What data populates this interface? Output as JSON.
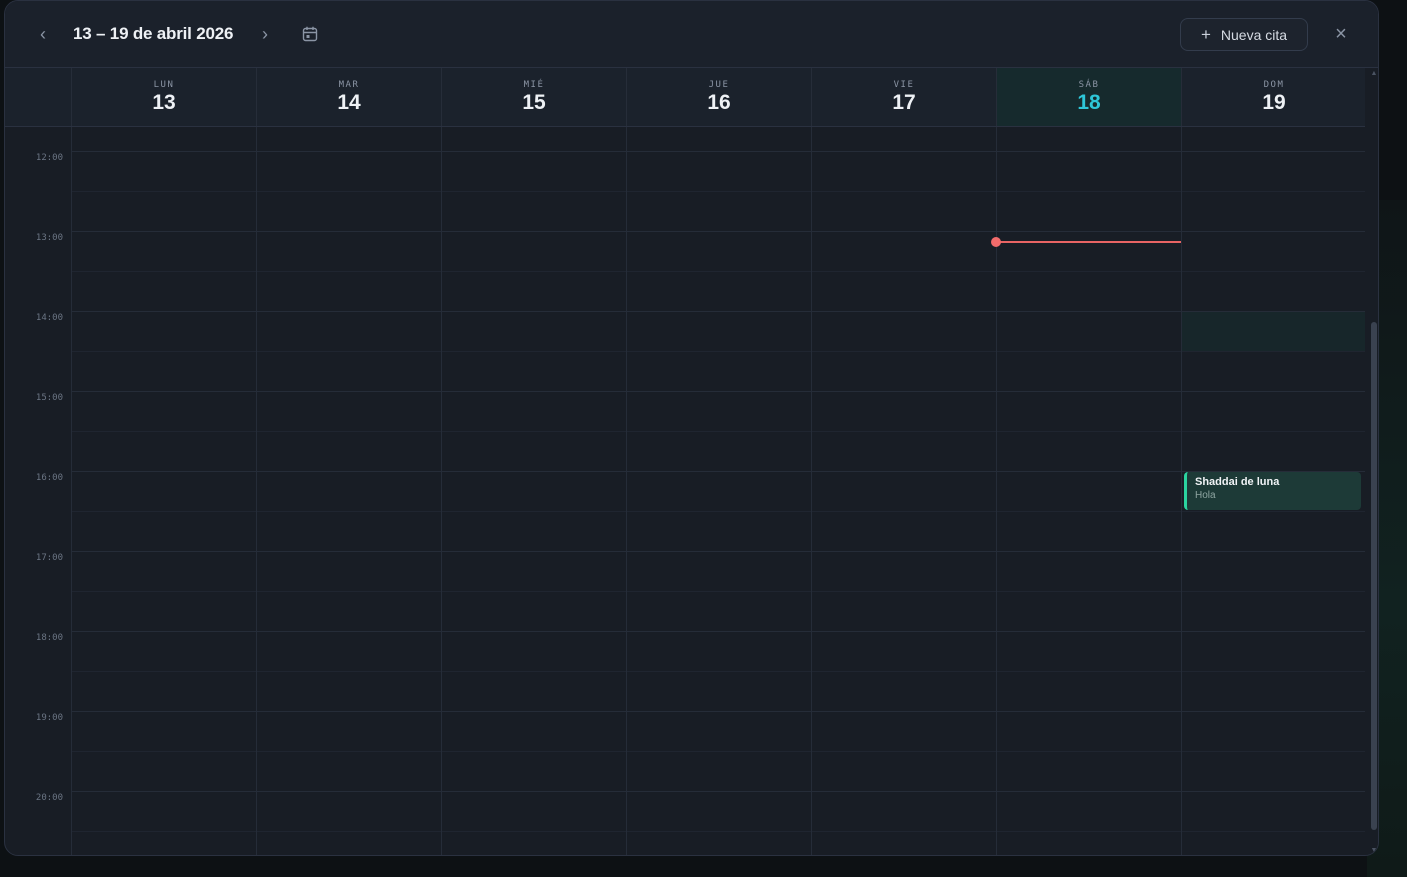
{
  "header": {
    "range_title": "13 – 19 de abril 2026",
    "new_button_label": "Nueva cita",
    "prev_icon": "chevron-left-icon",
    "next_icon": "chevron-right-icon",
    "calendar_icon": "calendar-icon",
    "close_icon": "close-icon"
  },
  "days": [
    {
      "dow": "LUN",
      "num": "13",
      "today": false
    },
    {
      "dow": "MAR",
      "num": "14",
      "today": false
    },
    {
      "dow": "MIÉ",
      "num": "15",
      "today": false
    },
    {
      "dow": "JUE",
      "num": "16",
      "today": false
    },
    {
      "dow": "VIE",
      "num": "17",
      "today": false
    },
    {
      "dow": "SÁB",
      "num": "18",
      "today": true
    },
    {
      "dow": "DOM",
      "num": "19",
      "today": false
    }
  ],
  "hours": [
    "12:00",
    "13:00",
    "14:00",
    "15:00",
    "16:00",
    "17:00",
    "18:00",
    "19:00",
    "20:00"
  ],
  "event": {
    "title": "Shaddai de luna",
    "subtitle": "Hola",
    "day": "DOM 19",
    "start": "16:00",
    "accent": "#2bd4a0"
  },
  "colors": {
    "today_accent": "#2ec6d8",
    "now_indicator": "#e86464",
    "background": "#181d25"
  }
}
